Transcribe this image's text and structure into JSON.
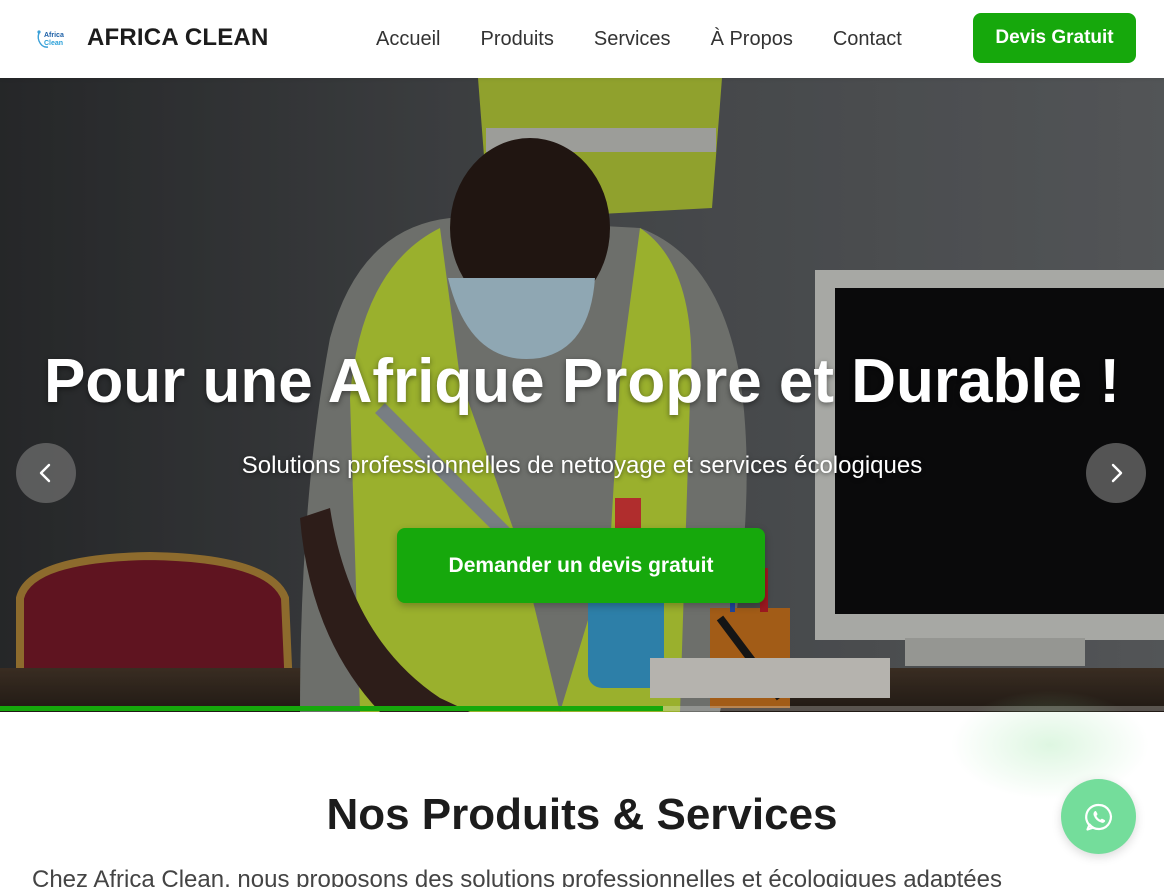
{
  "header": {
    "brand": "AFRICA CLEAN",
    "logo_text": "Africa Clean",
    "nav": [
      "Accueil",
      "Produits",
      "Services",
      "À Propos",
      "Contact"
    ],
    "cta": "Devis Gratuit"
  },
  "hero": {
    "title": "Pour une Afrique Propre et Durable !",
    "subtitle": "Solutions professionnelles de nettoyage et services écologiques",
    "cta": "Demander un devis gratuit",
    "slides_count": 3,
    "active_slide": 1,
    "progress_fraction": 0.57,
    "icons": {
      "prev": "chevron-left-icon",
      "next": "chevron-right-icon"
    }
  },
  "section": {
    "title": "Nos Produits & Services",
    "intro": "Chez Africa Clean, nous proposons des solutions professionnelles et écologiques adaptées"
  },
  "floating": {
    "icon": "whatsapp-icon"
  },
  "colors": {
    "accent": "#16a80c",
    "whatsapp": "#74dd9b",
    "text_dark": "#1c1c1c"
  }
}
